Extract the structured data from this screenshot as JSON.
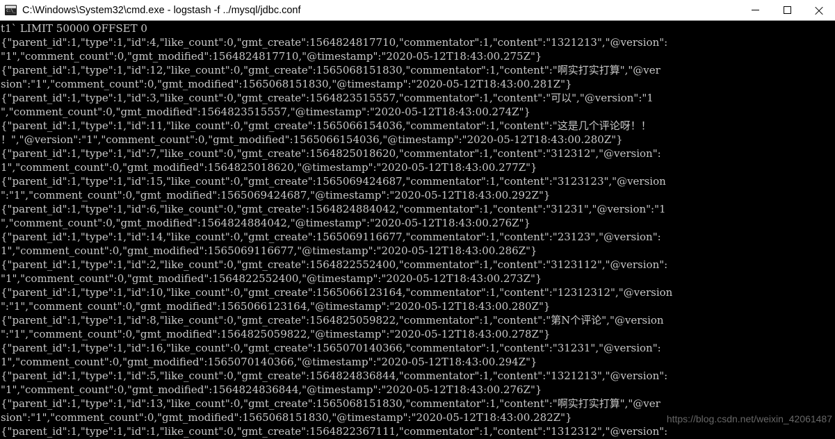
{
  "window": {
    "title": "C:\\Windows\\System32\\cmd.exe - logstash  -f ../mysql/jdbc.conf",
    "icon": "cmd-console-icon",
    "colors": {
      "titlebar_bg": "#ffffff",
      "titlebar_fg": "#000000",
      "console_bg": "#000000",
      "console_fg": "#c8c8c8",
      "watermark_fg": "#8a8a8a"
    },
    "buttons": {
      "minimize": "minimize-icon",
      "maximize": "maximize-icon",
      "close": "close-icon"
    }
  },
  "console": {
    "lines": [
      "t1` LIMIT 50000 OFFSET 0",
      "{\"parent_id\":1,\"type\":1,\"id\":4,\"like_count\":0,\"gmt_create\":1564824817710,\"commentator\":1,\"content\":\"1321213\",\"@version\":",
      "\"1\",\"comment_count\":0,\"gmt_modified\":1564824817710,\"@timestamp\":\"2020-05-12T18:43:00.275Z\"}",
      "{\"parent_id\":1,\"type\":1,\"id\":12,\"like_count\":0,\"gmt_create\":1565068151830,\"commentator\":1,\"content\":\"啊实打实打算\",\"@ver",
      "sion\":\"1\",\"comment_count\":0,\"gmt_modified\":1565068151830,\"@timestamp\":\"2020-05-12T18:43:00.281Z\"}",
      "{\"parent_id\":1,\"type\":1,\"id\":3,\"like_count\":0,\"gmt_create\":1564823515557,\"commentator\":1,\"content\":\"可以\",\"@version\":\"1",
      "\",\"comment_count\":0,\"gmt_modified\":1564823515557,\"@timestamp\":\"2020-05-12T18:43:00.274Z\"}",
      "{\"parent_id\":1,\"type\":1,\"id\":11,\"like_count\":0,\"gmt_create\":1565066154036,\"commentator\":1,\"content\":\"这是几个评论呀！！",
      "！\",\"@version\":\"1\",\"comment_count\":0,\"gmt_modified\":1565066154036,\"@timestamp\":\"2020-05-12T18:43:00.280Z\"}",
      "{\"parent_id\":1,\"type\":1,\"id\":7,\"like_count\":0,\"gmt_create\":1564825018620,\"commentator\":1,\"content\":\"312312\",\"@version\":",
      "1\",\"comment_count\":0,\"gmt_modified\":1564825018620,\"@timestamp\":\"2020-05-12T18:43:00.277Z\"}",
      "{\"parent_id\":1,\"type\":1,\"id\":15,\"like_count\":0,\"gmt_create\":1565069424687,\"commentator\":1,\"content\":\"3123123\",\"@version",
      "\":\"1\",\"comment_count\":0,\"gmt_modified\":1565069424687,\"@timestamp\":\"2020-05-12T18:43:00.292Z\"}",
      "{\"parent_id\":1,\"type\":1,\"id\":6,\"like_count\":0,\"gmt_create\":1564824884042,\"commentator\":1,\"content\":\"31231\",\"@version\":\"1",
      "\",\"comment_count\":0,\"gmt_modified\":1564824884042,\"@timestamp\":\"2020-05-12T18:43:00.276Z\"}",
      "{\"parent_id\":1,\"type\":1,\"id\":14,\"like_count\":0,\"gmt_create\":1565069116677,\"commentator\":1,\"content\":\"23123\",\"@version\":",
      "1\",\"comment_count\":0,\"gmt_modified\":1565069116677,\"@timestamp\":\"2020-05-12T18:43:00.286Z\"}",
      "{\"parent_id\":1,\"type\":1,\"id\":2,\"like_count\":0,\"gmt_create\":1564822552400,\"commentator\":1,\"content\":\"3123112\",\"@version\":",
      "\"1\",\"comment_count\":0,\"gmt_modified\":1564822552400,\"@timestamp\":\"2020-05-12T18:43:00.273Z\"}",
      "{\"parent_id\":1,\"type\":1,\"id\":10,\"like_count\":0,\"gmt_create\":1565066123164,\"commentator\":1,\"content\":\"12312312\",\"@version",
      "\":\"1\",\"comment_count\":0,\"gmt_modified\":1565066123164,\"@timestamp\":\"2020-05-12T18:43:00.280Z\"}",
      "{\"parent_id\":1,\"type\":1,\"id\":8,\"like_count\":0,\"gmt_create\":1564825059822,\"commentator\":1,\"content\":\"第N个评论\",\"@version",
      "\":\"1\",\"comment_count\":0,\"gmt_modified\":1564825059822,\"@timestamp\":\"2020-05-12T18:43:00.278Z\"}",
      "{\"parent_id\":1,\"type\":1,\"id\":16,\"like_count\":0,\"gmt_create\":1565070140366,\"commentator\":1,\"content\":\"31231\",\"@version\":",
      "1\",\"comment_count\":0,\"gmt_modified\":1565070140366,\"@timestamp\":\"2020-05-12T18:43:00.294Z\"}",
      "{\"parent_id\":1,\"type\":1,\"id\":5,\"like_count\":0,\"gmt_create\":1564824836844,\"commentator\":1,\"content\":\"1321213\",\"@version\":",
      "\"1\",\"comment_count\":0,\"gmt_modified\":1564824836844,\"@timestamp\":\"2020-05-12T18:43:00.276Z\"}",
      "{\"parent_id\":1,\"type\":1,\"id\":13,\"like_count\":0,\"gmt_create\":1565068151830,\"commentator\":1,\"content\":\"啊实打实打算\",\"@ver",
      "sion\":\"1\",\"comment_count\":0,\"gmt_modified\":1565068151830,\"@timestamp\":\"2020-05-12T18:43:00.282Z\"}",
      "{\"parent_id\":1,\"type\":1,\"id\":1,\"like_count\":0,\"gmt_create\":1564822367111,\"commentator\":1,\"content\":\"1312312\",\"@version\":"
    ]
  },
  "watermark": {
    "text": "https://blog.csdn.net/weixin_42061487"
  }
}
